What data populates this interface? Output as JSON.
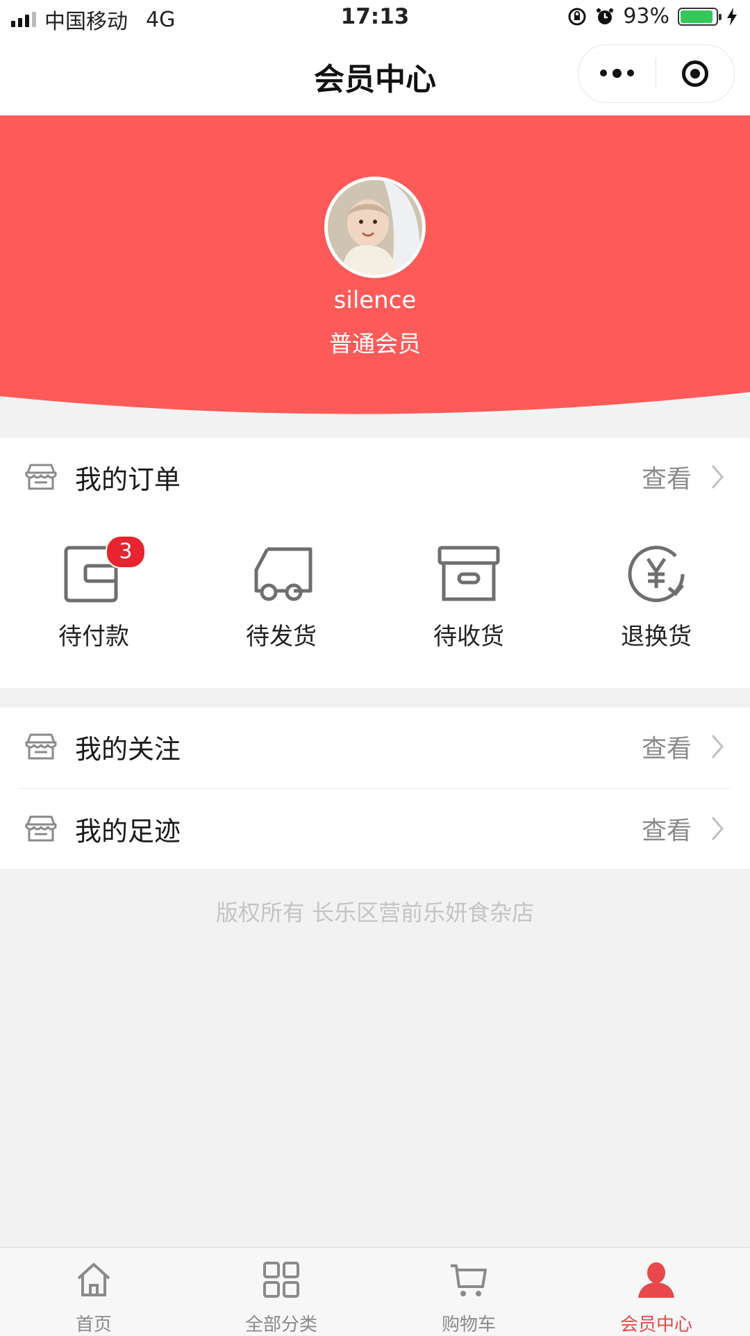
{
  "status_bar": {
    "carrier": "中国移动",
    "network": "4G",
    "time": "17:13",
    "battery_text": "93%",
    "battery_level": 0.93
  },
  "nav": {
    "title": "会员中心",
    "more_icon": "more-dots-icon",
    "close_icon": "target-icon"
  },
  "profile": {
    "username": "silence",
    "level": "普通会员",
    "header_color": "#ff5a5a"
  },
  "orders": {
    "title": "我的订单",
    "view_label": "查看",
    "items": [
      {
        "label": "待付款",
        "icon": "wallet-icon",
        "badge": "3"
      },
      {
        "label": "待发货",
        "icon": "truck-icon"
      },
      {
        "label": "待收货",
        "icon": "box-icon"
      },
      {
        "label": "退换货",
        "icon": "yen-refund-icon"
      }
    ]
  },
  "links": [
    {
      "title": "我的关注",
      "view_label": "查看"
    },
    {
      "title": "我的足迹",
      "view_label": "查看"
    }
  ],
  "copyright": "版权所有 长乐区营前乐妍食杂店",
  "tabbar": {
    "active_color": "#e8484c",
    "items": [
      {
        "label": "首页",
        "icon": "home-icon"
      },
      {
        "label": "全部分类",
        "icon": "grid-icon"
      },
      {
        "label": "购物车",
        "icon": "cart-icon"
      },
      {
        "label": "会员中心",
        "icon": "user-icon",
        "active": true
      }
    ]
  }
}
